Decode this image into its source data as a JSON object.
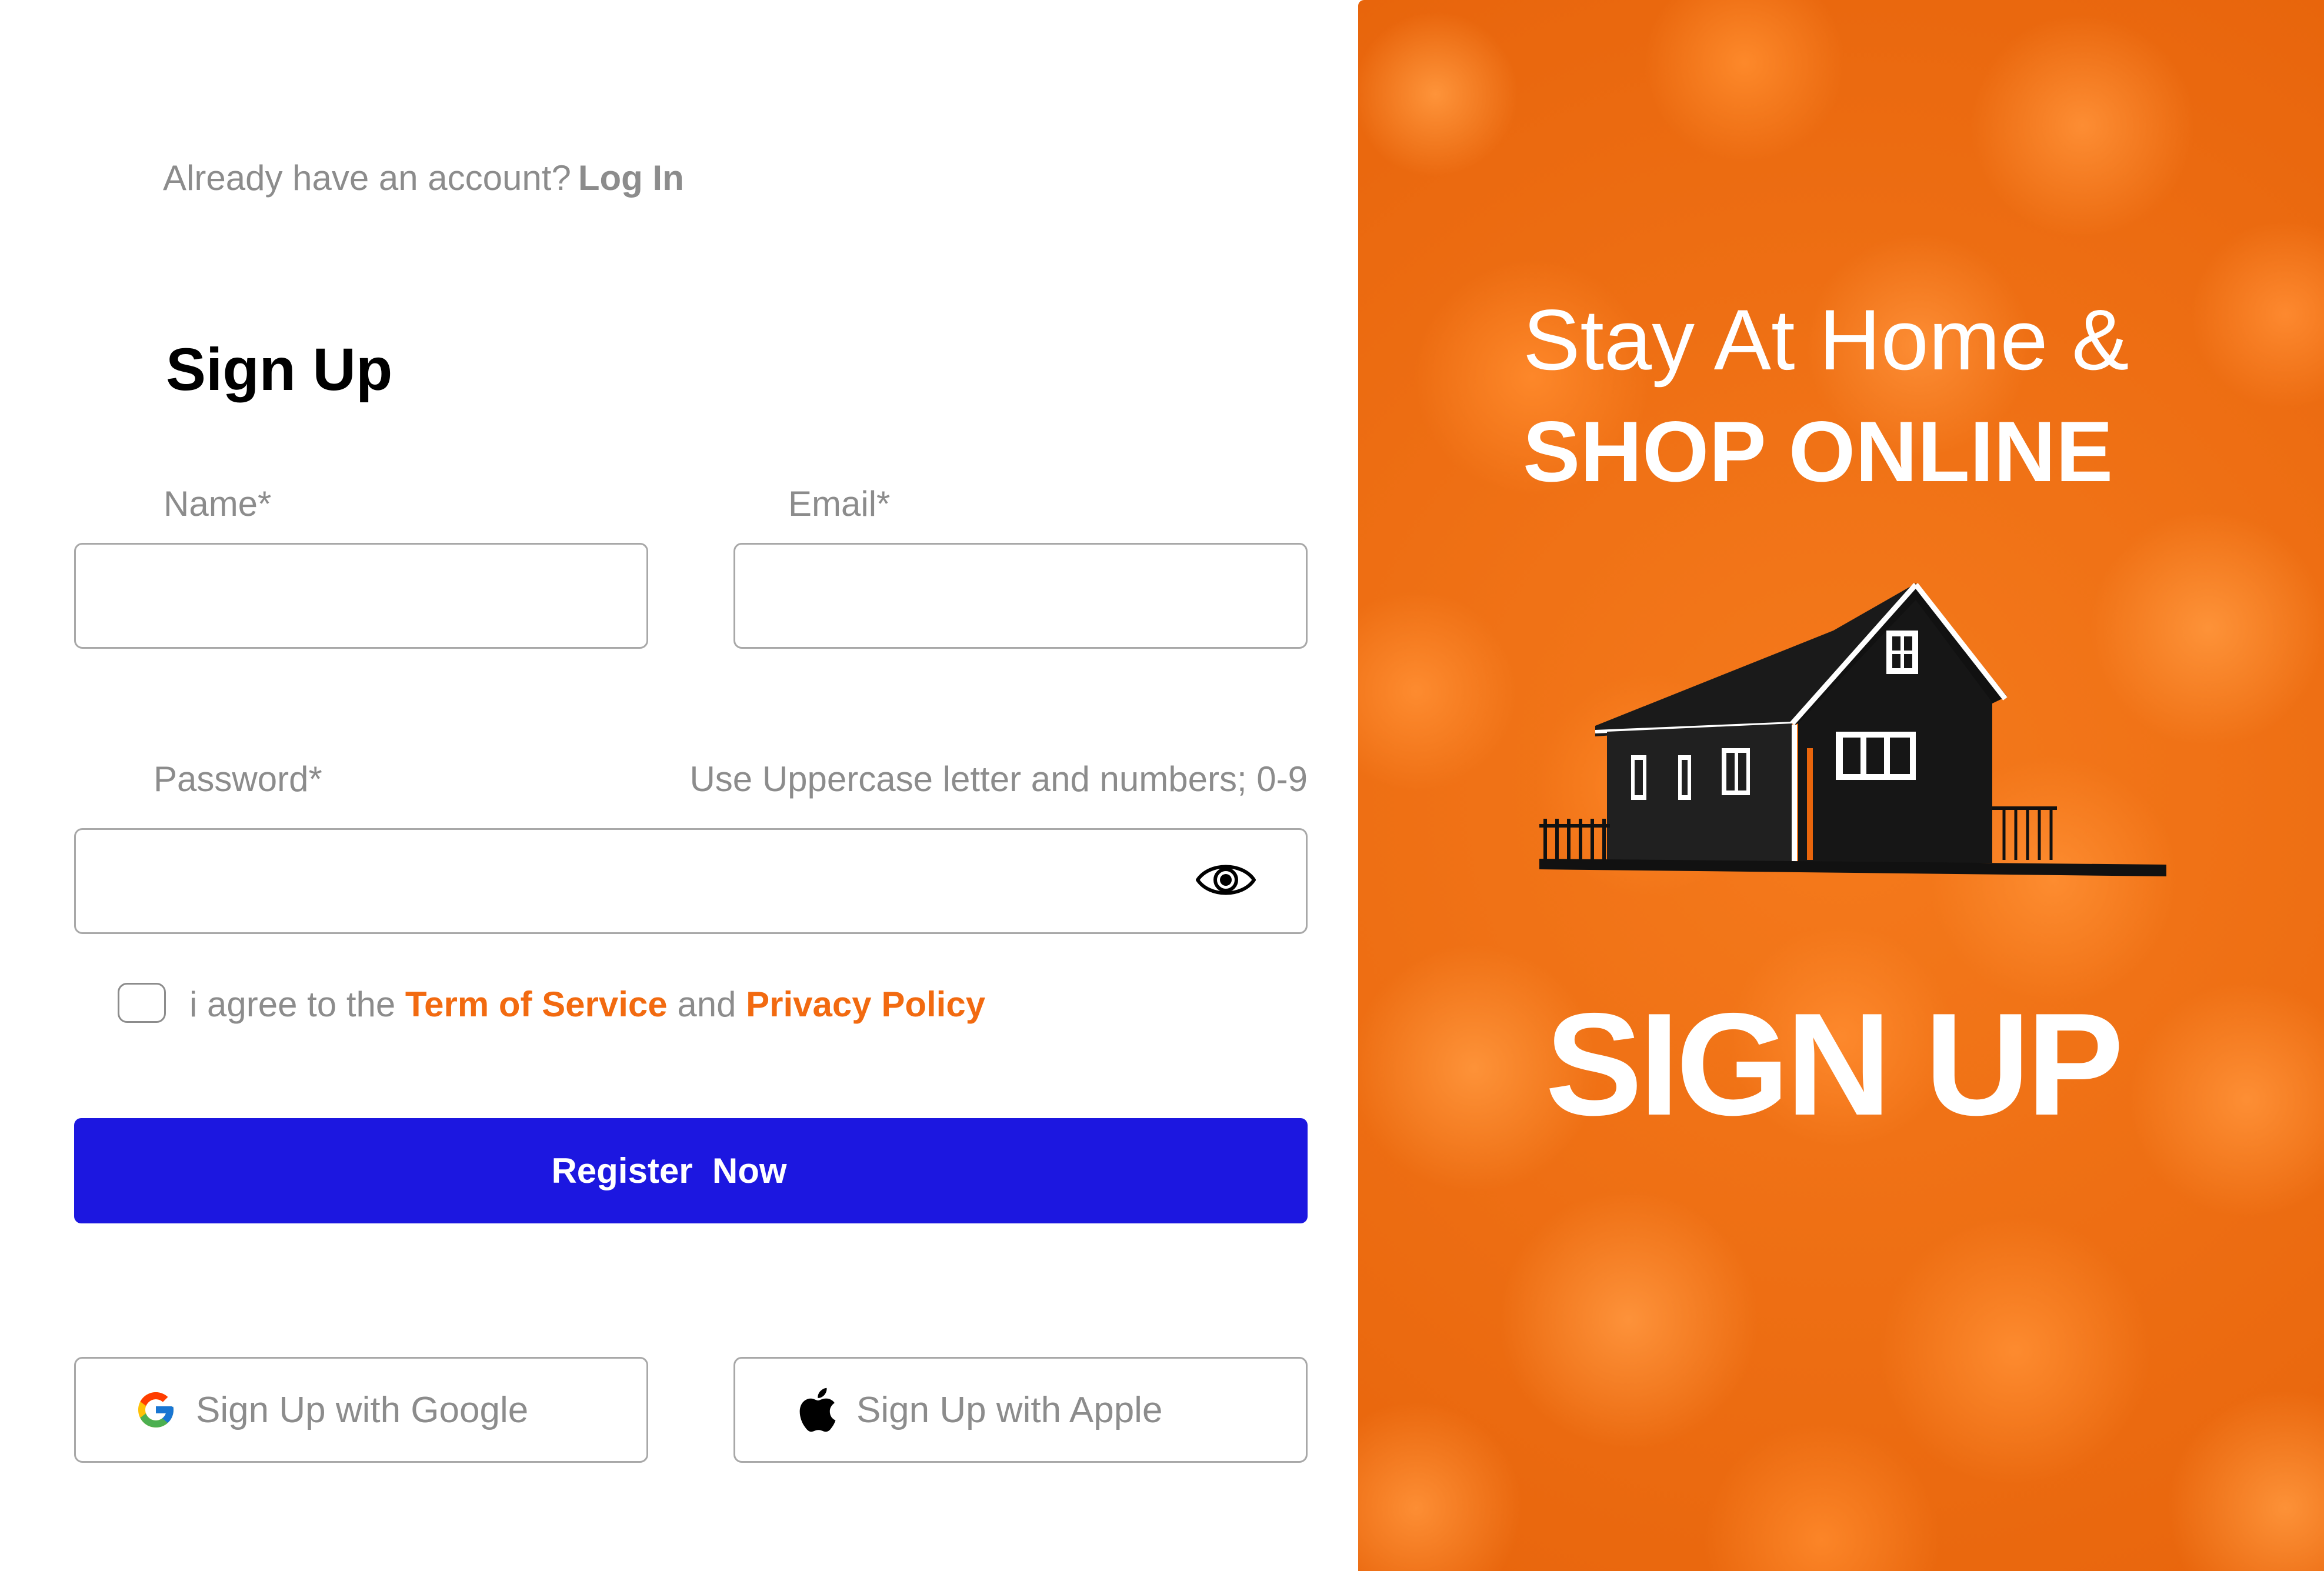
{
  "login_prompt": {
    "text": "Already have an account?",
    "link_label": "Log In"
  },
  "title": "Sign Up",
  "form": {
    "name": {
      "label": "Name*",
      "value": "",
      "placeholder": ""
    },
    "email": {
      "label": "Email*",
      "value": "",
      "placeholder": ""
    },
    "password": {
      "label": "Password*",
      "hint": "Use Uppercase letter and numbers; 0-9",
      "value": "",
      "placeholder": ""
    },
    "terms": {
      "checked": false,
      "prefix": "i agree to the",
      "terms_link": "Term of Service",
      "connector": "and",
      "privacy_link": "Privacy Policy"
    },
    "register_label": "Register  Now"
  },
  "social": {
    "google_label": "Sign Up with Google",
    "apple_label": "Sign Up with Apple"
  },
  "promo": {
    "line1": "Stay At Home &",
    "line2": "SHOP ONLINE",
    "cta": "SIGN UP"
  },
  "icons": {
    "password_toggle": "eye-icon",
    "google": "google-icon",
    "apple": "apple-icon",
    "illustration": "house-illustration"
  },
  "colors": {
    "accent_orange": "#f26a10",
    "primary_button": "#1c17e0",
    "muted_text": "#8c8c8c",
    "promo_background": "#f4771a"
  }
}
